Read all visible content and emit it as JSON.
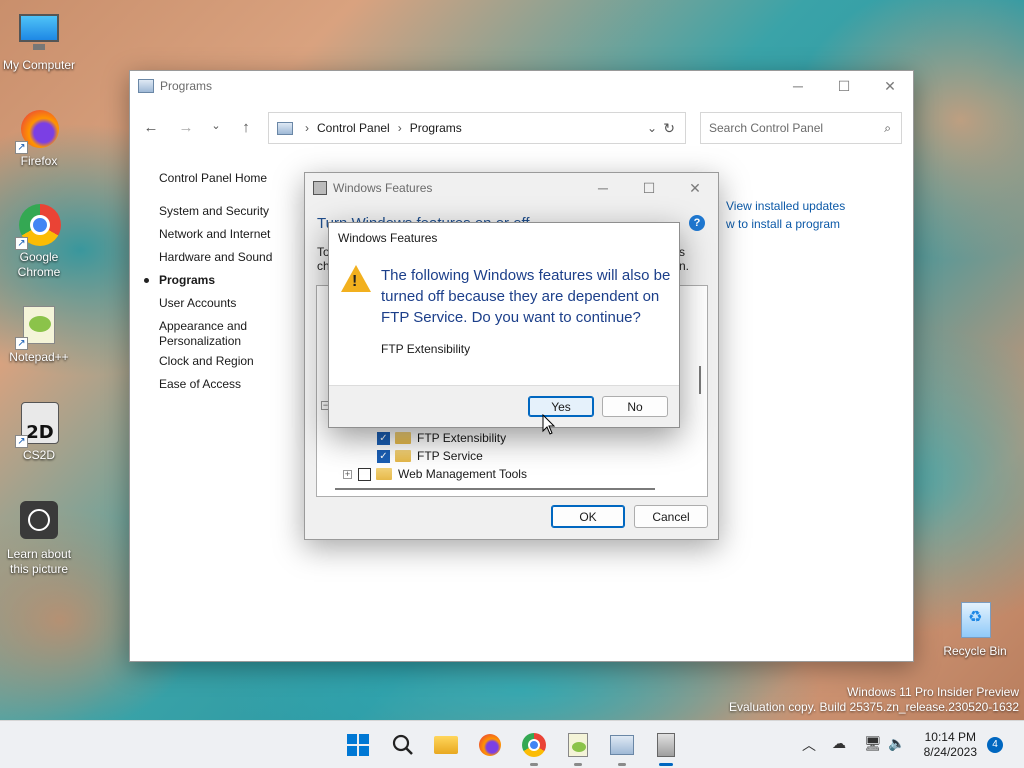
{
  "desktop": {
    "icons": [
      {
        "label": "My Computer"
      },
      {
        "label": "Firefox"
      },
      {
        "label": "Google Chrome"
      },
      {
        "label": "Notepad++"
      },
      {
        "label": "CS2D"
      },
      {
        "label": "Learn about this picture"
      },
      {
        "label": "Recycle Bin"
      }
    ],
    "watermark_line1": "Windows 11 Pro Insider Preview",
    "watermark_line2": "Evaluation copy. Build 25375.zn_release.230520-1632"
  },
  "programs_window": {
    "title": "Programs",
    "breadcrumb": [
      "Control Panel",
      "Programs"
    ],
    "search_placeholder": "Search Control Panel",
    "sidebar": [
      {
        "label": "Control Panel Home"
      },
      {
        "label": "System and Security"
      },
      {
        "label": "Network and Internet"
      },
      {
        "label": "Hardware and Sound"
      },
      {
        "label": "Programs",
        "active": true
      },
      {
        "label": "User Accounts"
      },
      {
        "label": "Appearance and Personalization"
      },
      {
        "label": "Clock and Region"
      },
      {
        "label": "Ease of Access"
      }
    ],
    "right_links": [
      "View installed updates",
      "w to install a program"
    ]
  },
  "features_dialog": {
    "title": "Windows Features",
    "heading": "Turn Windows features on or off",
    "desc_line1_start": "To",
    "desc_line1_end": "s",
    "desc_line2_start": "ch",
    "desc_line2_end": "n.",
    "tree": [
      {
        "label": "FTP Extensibility",
        "checked": true
      },
      {
        "label": "FTP Service",
        "checked": true
      },
      {
        "label": "Web Management Tools",
        "checked": false
      }
    ],
    "ok_label": "OK",
    "cancel_label": "Cancel"
  },
  "confirm_dialog": {
    "title": "Windows Features",
    "message": "The following Windows features will also be turned off because they are dependent on FTP Service. Do you want to continue?",
    "item": "FTP Extensibility",
    "yes_label": "Yes",
    "no_label": "No"
  },
  "taskbar": {
    "time": "10:14 PM",
    "date": "8/24/2023",
    "notification_count": "4"
  },
  "colors": {
    "accent": "#0067c0",
    "link": "#0d5aa8",
    "dialog_heading": "#1c3f8a",
    "warning": "#f2b01e"
  }
}
